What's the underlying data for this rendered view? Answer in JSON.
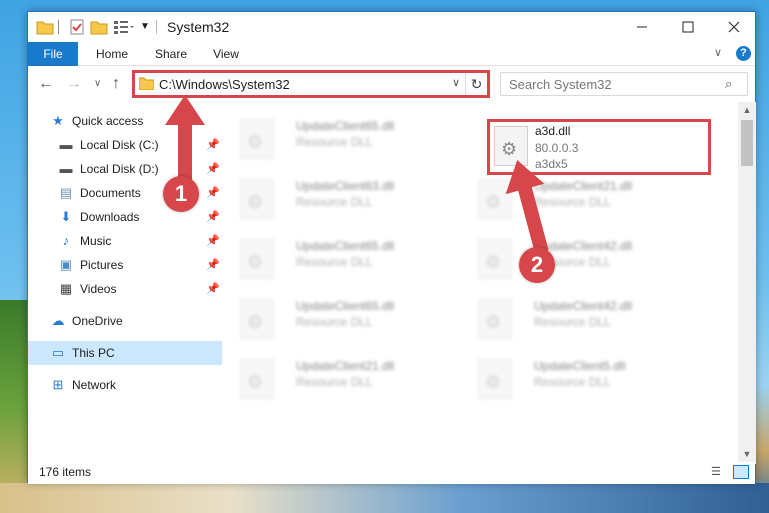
{
  "window": {
    "title": "System32"
  },
  "ribbon": {
    "tabs": [
      "File",
      "Home",
      "Share",
      "View"
    ]
  },
  "address": {
    "path": "C:\\Windows\\System32"
  },
  "search": {
    "placeholder": "Search System32"
  },
  "sidebar": {
    "items": [
      {
        "label": "Quick access",
        "icon": "star-icon",
        "pinned": false
      },
      {
        "label": "Local Disk (C:)",
        "icon": "drive-icon",
        "pinned": true
      },
      {
        "label": "Local Disk (D:)",
        "icon": "drive-icon",
        "pinned": true
      },
      {
        "label": "Documents",
        "icon": "documents-icon",
        "pinned": true
      },
      {
        "label": "Downloads",
        "icon": "download-icon",
        "pinned": true
      },
      {
        "label": "Music",
        "icon": "music-icon",
        "pinned": true
      },
      {
        "label": "Pictures",
        "icon": "pictures-icon",
        "pinned": true
      },
      {
        "label": "Videos",
        "icon": "videos-icon",
        "pinned": true
      },
      {
        "label": "OneDrive",
        "icon": "cloud-icon",
        "pinned": false
      },
      {
        "label": "This PC",
        "icon": "computer-icon",
        "pinned": false,
        "selected": true
      },
      {
        "label": "Network",
        "icon": "network-icon",
        "pinned": false
      }
    ]
  },
  "files": {
    "featured": {
      "name": "a3d.dll",
      "version": "80.0.0.3",
      "description": "a3dx5"
    },
    "left_column": [
      {
        "name": "UpdateClient65.dll",
        "type": "Resource DLL"
      },
      {
        "name": "UpdateClient63.dll",
        "type": "Resource DLL"
      },
      {
        "name": "UpdateClient65.dll",
        "type": "Resource DLL"
      },
      {
        "name": "UpdateClient65.dll",
        "type": "Resource DLL"
      },
      {
        "name": "UpdateClient21.dll",
        "type": "Resource DLL"
      }
    ],
    "right_column": [
      {
        "name": "UpdateClient21.dll",
        "type": "Resource DLL"
      },
      {
        "name": "UpdateClient42.dll",
        "type": "Resource DLL"
      },
      {
        "name": "UpdateClient42.dll",
        "type": "Resource DLL"
      },
      {
        "name": "UpdateClient5.dll",
        "type": "Resource DLL"
      }
    ]
  },
  "status": {
    "item_count": "176 items"
  },
  "annotations": {
    "step1": "1",
    "step2": "2",
    "color": "#d7464a"
  }
}
